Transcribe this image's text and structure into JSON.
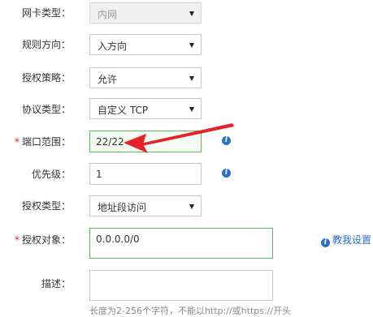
{
  "form": {
    "nic_type": {
      "label": "网卡类型：",
      "value": "内网"
    },
    "direction": {
      "label": "规则方向：",
      "value": "入方向"
    },
    "policy": {
      "label": "授权策略：",
      "value": "允许"
    },
    "protocol": {
      "label": "协议类型：",
      "value": "自定义 TCP"
    },
    "port_range": {
      "required_mark": "*",
      "label": "端口范围：",
      "value": "22/22"
    },
    "priority": {
      "label": "优先级：",
      "value": "1"
    },
    "auth_type": {
      "label": "授权类型：",
      "value": "地址段访问"
    },
    "auth_object": {
      "required_mark": "*",
      "label": "授权对象：",
      "value": "0.0.0.0/0",
      "help_link": "教我设置"
    },
    "description": {
      "label": "描述：",
      "value": "",
      "hint": "长度为2-256个字符，不能以http://或https://开头"
    }
  },
  "icons": {
    "info": "info-icon",
    "dropdown": "chevron-down-icon",
    "annotation": "red-arrow"
  },
  "colors": {
    "valid_border": "#5cb85c",
    "info": "#2a6fc9",
    "required": "#e02020",
    "annotation": "#e8202a"
  }
}
